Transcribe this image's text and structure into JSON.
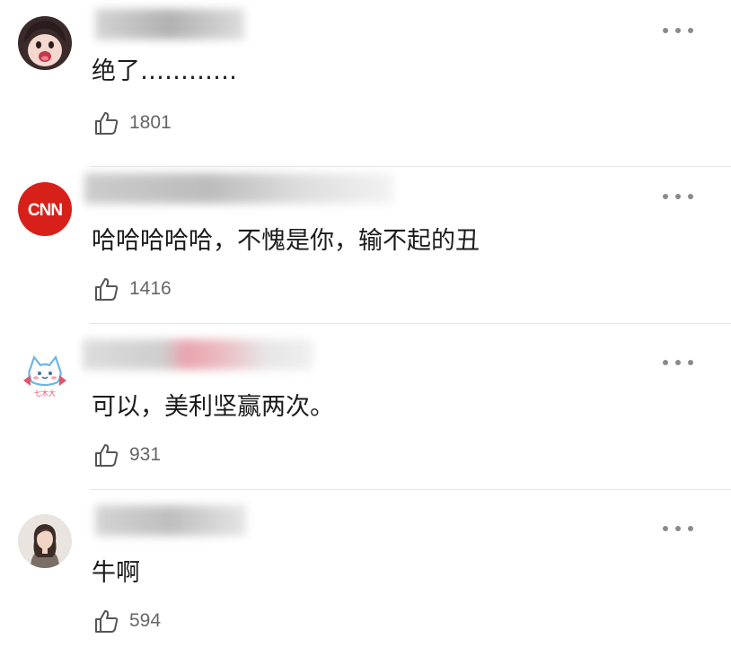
{
  "comments": [
    {
      "avatar": "cartoon-girl-avatar",
      "text": "绝了…………",
      "likes": "1801"
    },
    {
      "avatar": "cnn-logo-avatar",
      "text": "哈哈哈哈哈，不愧是你，输不起的丑",
      "likes": "1416"
    },
    {
      "avatar": "cat-sticker-avatar",
      "text": "可以，美利坚赢两次。",
      "likes": "931"
    },
    {
      "avatar": "portrait-photo-avatar",
      "text": "牛啊",
      "likes": "594"
    }
  ],
  "icons": {
    "like": "thumbs-up-icon",
    "more": "more-dots-icon"
  },
  "colors": {
    "text": "#1b1b1b",
    "count": "#666666",
    "icon": "#555555",
    "divider": "#e6e6e6",
    "cnn_red": "#d8201a"
  }
}
